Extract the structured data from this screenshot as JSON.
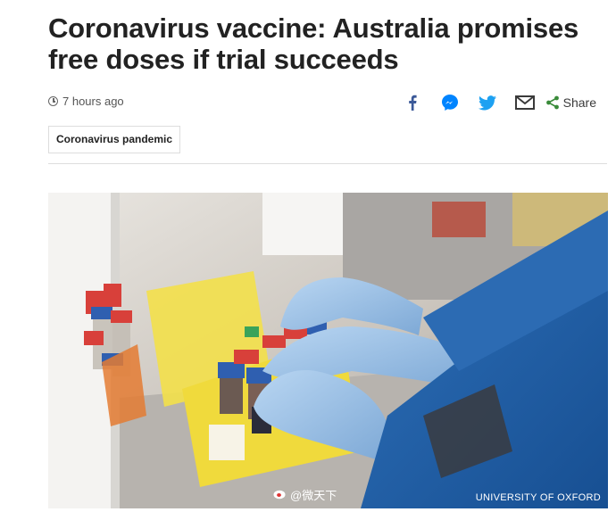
{
  "article": {
    "headline_line1": "Coronavirus vaccine: Australia promises",
    "headline_line2": "free doses if trial succeeds",
    "timestamp": "7 hours ago",
    "topic_tag": "Coronavirus pandemic"
  },
  "share": {
    "label": "Share",
    "icons": [
      "facebook-icon",
      "messenger-icon",
      "twitter-icon",
      "email-icon",
      "share-icon"
    ],
    "colors": {
      "facebook": "#3b5998",
      "messenger": "#0084ff",
      "twitter": "#1da1f2",
      "email": "#3a3a3a",
      "share": "#3a8b3a"
    }
  },
  "photo": {
    "credit": "UNIVERSITY OF OXFORD",
    "watermark": "@微天下"
  }
}
